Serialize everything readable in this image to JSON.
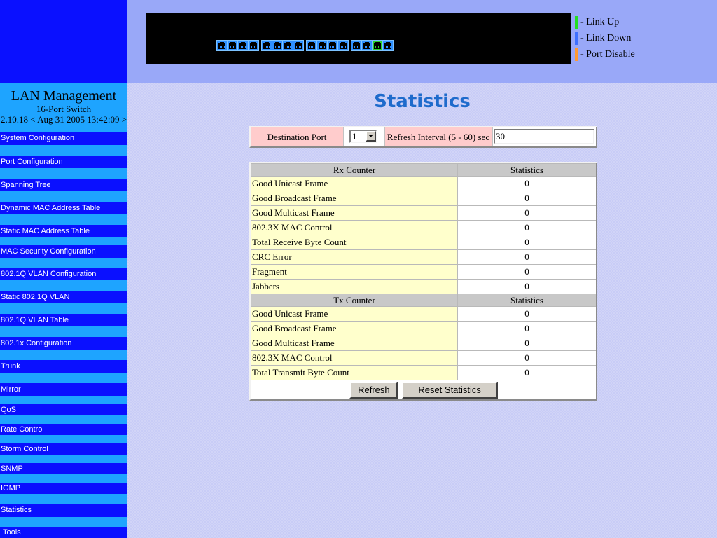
{
  "sidebar": {
    "title": "LAN Management",
    "subtitle": "16-Port Switch",
    "version": "2.10.18 < Aug 31 2005 13:42:09 >",
    "menu": [
      {
        "label": "System Configuration"
      },
      {
        "label": "Port Configuration"
      },
      {
        "label": "Spanning Tree"
      },
      {
        "label": "Dynamic MAC Address Table"
      },
      {
        "label": "Static MAC Address Table"
      },
      {
        "label": "MAC Security Configuration"
      },
      {
        "label": "802.1Q VLAN Configuration"
      },
      {
        "label": "Static 802.1Q VLAN"
      },
      {
        "label": "802.1Q VLAN Table"
      },
      {
        "label": "802.1x Configuration"
      },
      {
        "label": "Trunk"
      },
      {
        "label": "Mirror"
      },
      {
        "label": "QoS"
      },
      {
        "label": "Rate Control"
      },
      {
        "label": "Storm Control"
      },
      {
        "label": "SNMP"
      },
      {
        "label": "IGMP"
      },
      {
        "label": "Statistics"
      },
      {
        "label": "Tools"
      }
    ]
  },
  "header": {
    "port_link_up": [
      false,
      false,
      false,
      false,
      false,
      false,
      false,
      false,
      false,
      false,
      false,
      false,
      false,
      false,
      true,
      false
    ],
    "port_colors": {
      "link_up": "#2bd12b",
      "link_down": "#2f8fff"
    },
    "legend": [
      {
        "label": "- Link Up",
        "color": "#22dd22"
      },
      {
        "label": "- Link Down",
        "color": "#3f6fff"
      },
      {
        "label": "- Port Disable",
        "color": "#ff9933"
      }
    ]
  },
  "main": {
    "title": "Statistics",
    "controls": {
      "destination_port": {
        "label": "Destination Port",
        "value": "1"
      },
      "refresh_interval": {
        "label": "Refresh Interval (5 - 60) sec",
        "value": "30"
      }
    },
    "rx": {
      "counter_header": "Rx Counter",
      "stat_header": "Statistics",
      "rows": [
        {
          "label": "Good Unicast Frame",
          "value": "0"
        },
        {
          "label": "Good Broadcast Frame",
          "value": "0"
        },
        {
          "label": "Good Multicast Frame",
          "value": "0"
        },
        {
          "label": "802.3X MAC Control",
          "value": "0"
        },
        {
          "label": "Total Receive Byte Count",
          "value": "0"
        },
        {
          "label": "CRC Error",
          "value": "0"
        },
        {
          "label": "Fragment",
          "value": "0"
        },
        {
          "label": "Jabbers",
          "value": "0"
        }
      ]
    },
    "tx": {
      "counter_header": "Tx Counter",
      "stat_header": "Statistics",
      "rows": [
        {
          "label": "Good Unicast Frame",
          "value": "0"
        },
        {
          "label": "Good Broadcast Frame",
          "value": "0"
        },
        {
          "label": "Good Multicast Frame",
          "value": "0"
        },
        {
          "label": "802.3X MAC Control",
          "value": "0"
        },
        {
          "label": "Total Transmit Byte Count",
          "value": "0"
        }
      ]
    },
    "buttons": {
      "refresh": "Refresh",
      "reset": "Reset Statistics"
    }
  },
  "colors": {
    "sidebar_dark": "#0a10ff",
    "sidebar_light": "#1ea4ff",
    "header_bg": "#99a8f8",
    "main_bg": "#c8ccf6",
    "title": "#1e6bcc",
    "label_cell": "#ffffcc",
    "control_label_cell": "#ffcccc",
    "table_header": "#c8c8c8",
    "button_face": "#d4d0c8"
  }
}
